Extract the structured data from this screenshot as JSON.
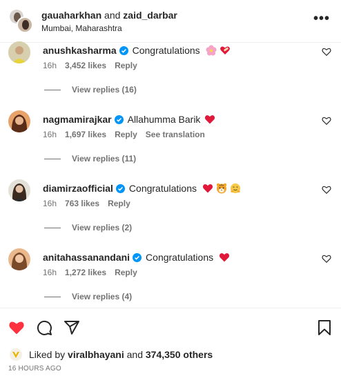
{
  "header": {
    "user1": "gauaharkhan",
    "and_text": "and",
    "user2": "zaid_darbar",
    "location": "Mumbai, Maharashtra",
    "more_icon": "more-horizontal-icon"
  },
  "comments": [
    {
      "username": "anushkasharma",
      "verified": true,
      "text": "Congratulations",
      "emojis": [
        "cherry-blossom-emoji",
        "heart-bandage-emoji"
      ],
      "time": "16h",
      "likes": "3,452 likes",
      "reply": "Reply",
      "translation": "",
      "replies": "View replies (16)"
    },
    {
      "username": "nagmamirajkar",
      "verified": true,
      "text": "Allahumma Barik",
      "emojis": [
        "red-heart-emoji"
      ],
      "time": "16h",
      "likes": "1,697 likes",
      "reply": "Reply",
      "translation": "See translation",
      "replies": "View replies (11)"
    },
    {
      "username": "diamirzaofficial",
      "verified": true,
      "text": "Congratulations",
      "emojis": [
        "red-heart-emoji",
        "tiger-face-emoji",
        "hugging-face-emoji"
      ],
      "time": "16h",
      "likes": "763 likes",
      "reply": "Reply",
      "translation": "",
      "replies": "View replies (2)"
    },
    {
      "username": "anitahassanandani",
      "verified": true,
      "text": "Congratulations",
      "emojis": [
        "red-heart-emoji"
      ],
      "time": "16h",
      "likes": "1,272 likes",
      "reply": "Reply",
      "translation": "",
      "replies": "View replies (4)"
    }
  ],
  "actions": {
    "like_icon": "heart-filled-icon",
    "comment_icon": "comment-icon",
    "share_icon": "paper-plane-icon",
    "save_icon": "bookmark-icon"
  },
  "likes_summary": {
    "prefix": "Liked by",
    "user": "viralbhayani",
    "middle": "and",
    "others": "374,350 others"
  },
  "timestamp": "16 HOURS AGO",
  "colors": {
    "like_red": "#ff3040",
    "verified_blue": "#0095f6",
    "text": "#262626",
    "secondary": "#737373"
  }
}
